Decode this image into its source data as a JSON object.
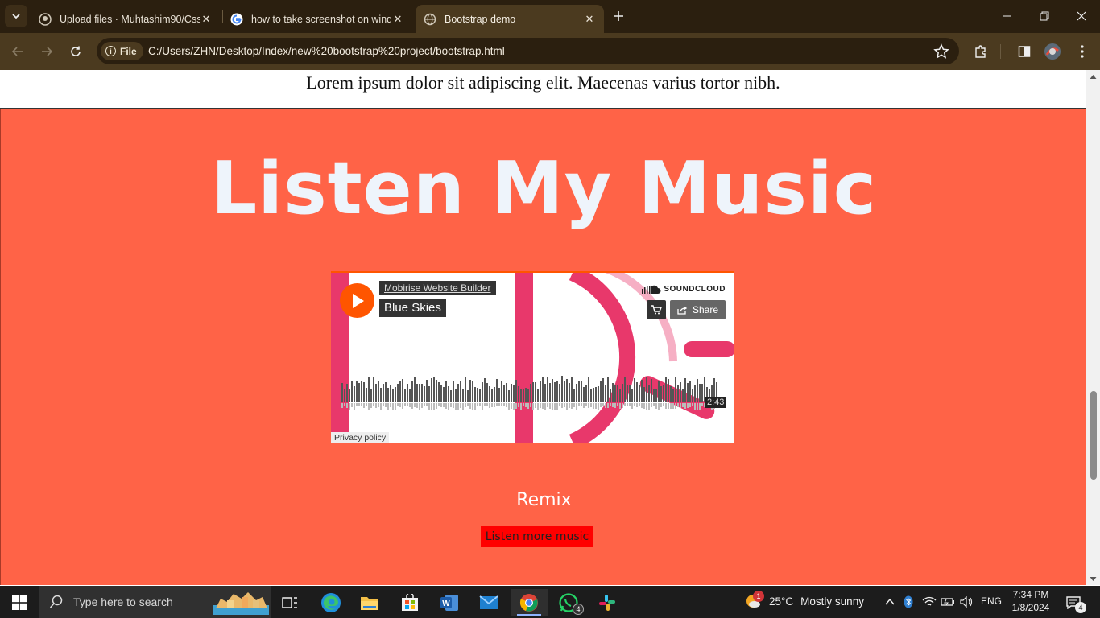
{
  "browser": {
    "tabs": [
      {
        "title": "Upload files · Muhtashim90/Css",
        "favicon": "github-icon",
        "active": false
      },
      {
        "title": "how to take screenshot on wind",
        "favicon": "google-icon",
        "active": false
      },
      {
        "title": "Bootstrap demo",
        "favicon": "globe-icon",
        "active": true
      }
    ],
    "site_chip": "File",
    "url": "C:/Users/ZHN/Desktop/Index/new%20bootstrap%20project/bootstrap.html"
  },
  "page": {
    "lorem": "Lorem ipsum dolor sit adipiscing elit. Maecenas varius tortor nibh.",
    "music_title": "Listen My Music",
    "background_color": "#ff6347",
    "player": {
      "artist": "Mobirise Website Builder",
      "track": "Blue Skies",
      "brand": "SOUNDCLOUD",
      "share_label": "Share",
      "duration": "2:43",
      "privacy": "Privacy policy",
      "accent": "#ff5500"
    },
    "remix": "Remix",
    "more_button": "Listen more music"
  },
  "taskbar": {
    "search_placeholder": "Type here to search",
    "weather_temp": "25°C",
    "weather_desc": "Mostly sunny",
    "weather_badge": "1",
    "language": "ENG",
    "time": "7:34 PM",
    "date": "1/8/2024",
    "notification_count": "4",
    "whatsapp_badge": "4"
  }
}
